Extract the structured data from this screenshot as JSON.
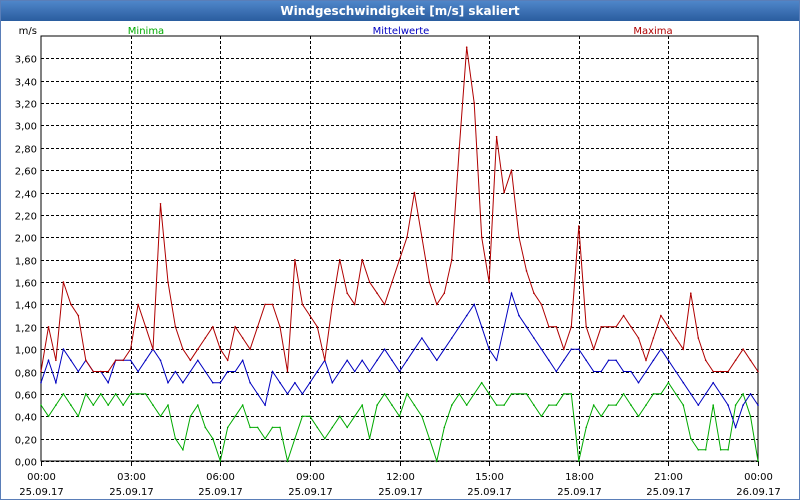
{
  "window": {
    "title": "Windgeschwindigkeit [m/s] skaliert"
  },
  "chart_data": {
    "type": "line",
    "title": "Windgeschwindigkeit [m/s] skaliert",
    "ylabel": "m/s",
    "xlabel": "",
    "ylim": [
      0,
      3.8
    ],
    "xlim": [
      0,
      24
    ],
    "grid": true,
    "legend_placement": "top",
    "yticks": [
      "0,00",
      "0,20",
      "0,40",
      "0,60",
      "0,80",
      "1,00",
      "1,20",
      "1,40",
      "1,60",
      "1,80",
      "2,00",
      "2,20",
      "2,40",
      "2,60",
      "2,80",
      "3,00",
      "3,20",
      "3,40",
      "3,60"
    ],
    "xticks": [
      {
        "time": "00:00",
        "date": "25.09.17"
      },
      {
        "time": "03:00",
        "date": "25.09.17"
      },
      {
        "time": "06:00",
        "date": "25.09.17"
      },
      {
        "time": "09:00",
        "date": "25.09.17"
      },
      {
        "time": "12:00",
        "date": "25.09.17"
      },
      {
        "time": "15:00",
        "date": "25.09.17"
      },
      {
        "time": "18:00",
        "date": "25.09.17"
      },
      {
        "time": "21:00",
        "date": "25.09.17"
      },
      {
        "time": "00:00",
        "date": "26.09.17"
      }
    ],
    "x": [
      0,
      0.25,
      0.5,
      0.75,
      1,
      1.25,
      1.5,
      1.75,
      2,
      2.25,
      2.5,
      2.75,
      3,
      3.25,
      3.5,
      3.75,
      4,
      4.25,
      4.5,
      4.75,
      5,
      5.25,
      5.5,
      5.75,
      6,
      6.25,
      6.5,
      6.75,
      7,
      7.25,
      7.5,
      7.75,
      8,
      8.25,
      8.5,
      8.75,
      9,
      9.25,
      9.5,
      9.75,
      10,
      10.25,
      10.5,
      10.75,
      11,
      11.25,
      11.5,
      11.75,
      12,
      12.25,
      12.5,
      12.75,
      13,
      13.25,
      13.5,
      13.75,
      14,
      14.25,
      14.5,
      14.75,
      15,
      15.25,
      15.5,
      15.75,
      16,
      16.25,
      16.5,
      16.75,
      17,
      17.25,
      17.5,
      17.75,
      18,
      18.25,
      18.5,
      18.75,
      19,
      19.25,
      19.5,
      19.75,
      20,
      20.25,
      20.5,
      20.75,
      21,
      21.25,
      21.5,
      21.75,
      22,
      22.25,
      22.5,
      22.75,
      23,
      23.25,
      23.5,
      23.75,
      24
    ],
    "series": [
      {
        "name": "Minima",
        "color": "#00aa00",
        "values": [
          0.5,
          0.4,
          0.5,
          0.6,
          0.5,
          0.4,
          0.6,
          0.5,
          0.6,
          0.5,
          0.6,
          0.5,
          0.6,
          0.6,
          0.6,
          0.5,
          0.4,
          0.5,
          0.2,
          0.1,
          0.4,
          0.5,
          0.3,
          0.2,
          0.0,
          0.3,
          0.4,
          0.5,
          0.3,
          0.3,
          0.2,
          0.3,
          0.3,
          0.0,
          0.2,
          0.4,
          0.4,
          0.3,
          0.2,
          0.3,
          0.4,
          0.3,
          0.4,
          0.5,
          0.2,
          0.5,
          0.6,
          0.5,
          0.4,
          0.6,
          0.5,
          0.4,
          0.2,
          0.0,
          0.3,
          0.5,
          0.6,
          0.5,
          0.6,
          0.7,
          0.6,
          0.5,
          0.5,
          0.6,
          0.6,
          0.6,
          0.5,
          0.4,
          0.5,
          0.5,
          0.6,
          0.6,
          0.0,
          0.3,
          0.5,
          0.4,
          0.5,
          0.5,
          0.6,
          0.5,
          0.4,
          0.5,
          0.6,
          0.6,
          0.7,
          0.6,
          0.5,
          0.2,
          0.1,
          0.1,
          0.5,
          0.1,
          0.1,
          0.5,
          0.6,
          0.4,
          0.0
        ]
      },
      {
        "name": "Mittelwerte",
        "color": "#0000c0",
        "values": [
          0.7,
          0.9,
          0.7,
          1.0,
          0.9,
          0.8,
          0.9,
          0.8,
          0.8,
          0.7,
          0.9,
          0.9,
          0.9,
          0.8,
          0.9,
          1.0,
          0.9,
          0.7,
          0.8,
          0.7,
          0.8,
          0.9,
          0.8,
          0.7,
          0.7,
          0.8,
          0.8,
          0.9,
          0.7,
          0.6,
          0.5,
          0.8,
          0.7,
          0.6,
          0.7,
          0.6,
          0.7,
          0.8,
          0.9,
          0.7,
          0.8,
          0.9,
          0.8,
          0.9,
          0.8,
          0.9,
          1.0,
          0.9,
          0.8,
          0.9,
          1.0,
          1.1,
          1.0,
          0.9,
          1.0,
          1.1,
          1.2,
          1.3,
          1.4,
          1.2,
          1.0,
          0.9,
          1.2,
          1.5,
          1.3,
          1.2,
          1.1,
          1.0,
          0.9,
          0.8,
          0.9,
          1.0,
          1.0,
          0.9,
          0.8,
          0.8,
          0.9,
          0.9,
          0.8,
          0.8,
          0.7,
          0.8,
          0.9,
          1.0,
          0.9,
          0.8,
          0.7,
          0.6,
          0.5,
          0.6,
          0.7,
          0.6,
          0.5,
          0.3,
          0.5,
          0.6,
          0.5
        ]
      },
      {
        "name": "Maxima",
        "color": "#b00000",
        "values": [
          0.8,
          1.2,
          0.9,
          1.6,
          1.4,
          1.3,
          0.9,
          0.8,
          0.8,
          0.8,
          0.9,
          0.9,
          1.0,
          1.4,
          1.2,
          1.0,
          2.3,
          1.6,
          1.2,
          1.0,
          0.9,
          1.0,
          1.1,
          1.2,
          1.0,
          0.9,
          1.2,
          1.1,
          1.0,
          1.2,
          1.4,
          1.4,
          1.2,
          0.8,
          1.8,
          1.4,
          1.3,
          1.2,
          0.9,
          1.4,
          1.8,
          1.5,
          1.4,
          1.8,
          1.6,
          1.5,
          1.4,
          1.6,
          1.8,
          2.0,
          2.4,
          2.0,
          1.6,
          1.4,
          1.5,
          1.8,
          2.8,
          3.7,
          3.2,
          2.0,
          1.6,
          2.9,
          2.4,
          2.6,
          2.0,
          1.7,
          1.5,
          1.4,
          1.2,
          1.2,
          1.0,
          1.2,
          2.1,
          1.2,
          1.0,
          1.2,
          1.2,
          1.2,
          1.3,
          1.2,
          1.1,
          0.9,
          1.1,
          1.3,
          1.2,
          1.1,
          1.0,
          1.5,
          1.1,
          0.9,
          0.8,
          0.8,
          0.8,
          0.9,
          1.0,
          0.9,
          0.8
        ]
      }
    ]
  }
}
